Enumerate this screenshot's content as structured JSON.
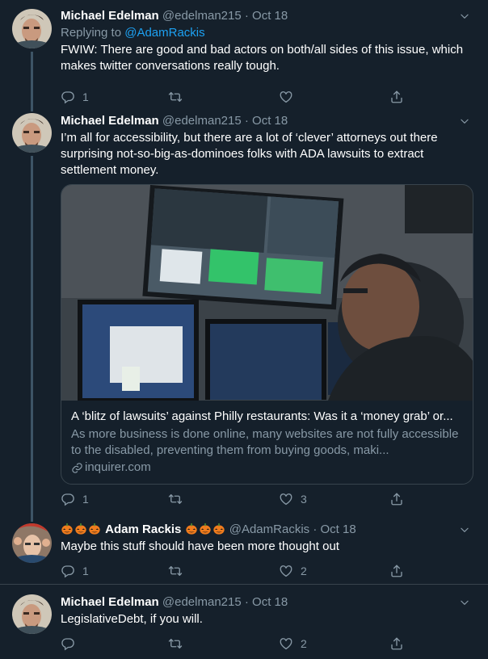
{
  "tweets": [
    {
      "name": "Michael Edelman",
      "handle": "@edelman215",
      "separator": "·",
      "date": "Oct 18",
      "replying_prefix": "Replying to",
      "replying_to": "@AdamRackis",
      "text": "FWIW: There are good and bad actors on both/all sides of this issue, which makes twitter conversations really tough.",
      "reply_count": "1",
      "retweet_count": "",
      "like_count": ""
    },
    {
      "name": "Michael Edelman",
      "handle": "@edelman215",
      "separator": "·",
      "date": "Oct 18",
      "text": "I’m all for accessibility, but there are a lot of ‘clever’ attorneys out there surprising not-so-big-as-dominoes folks with ADA lawsuits to extract settlement money.",
      "card": {
        "title": "A ‘blitz of lawsuits’ against Philly restaurants: Was it a ‘money grab’ or...",
        "description": "As more business is done online, many websites are not fully accessible to the disabled, preventing them from buying goods, maki...",
        "domain": "inquirer.com"
      },
      "reply_count": "1",
      "retweet_count": "",
      "like_count": "3"
    },
    {
      "name": "Adam Rackis",
      "handle": "@AdamRackis",
      "separator": "·",
      "date": "Oct 18",
      "text": "Maybe this stuff should have been more thought out",
      "reply_count": "1",
      "retweet_count": "",
      "like_count": "2"
    },
    {
      "name": "Michael Edelman",
      "handle": "@edelman215",
      "separator": "·",
      "date": "Oct 18",
      "text": "LegislativeDebt, if you will.",
      "reply_count": "",
      "retweet_count": "",
      "like_count": "2"
    }
  ],
  "colors": {
    "background": "#15202b",
    "secondary_text": "#8899a6",
    "link": "#1da1f2",
    "border": "#38444d"
  },
  "icons": [
    "reply-icon",
    "retweet-icon",
    "like-icon",
    "share-icon",
    "caret-down-icon",
    "link-icon",
    "pumpkin-emoji"
  ]
}
